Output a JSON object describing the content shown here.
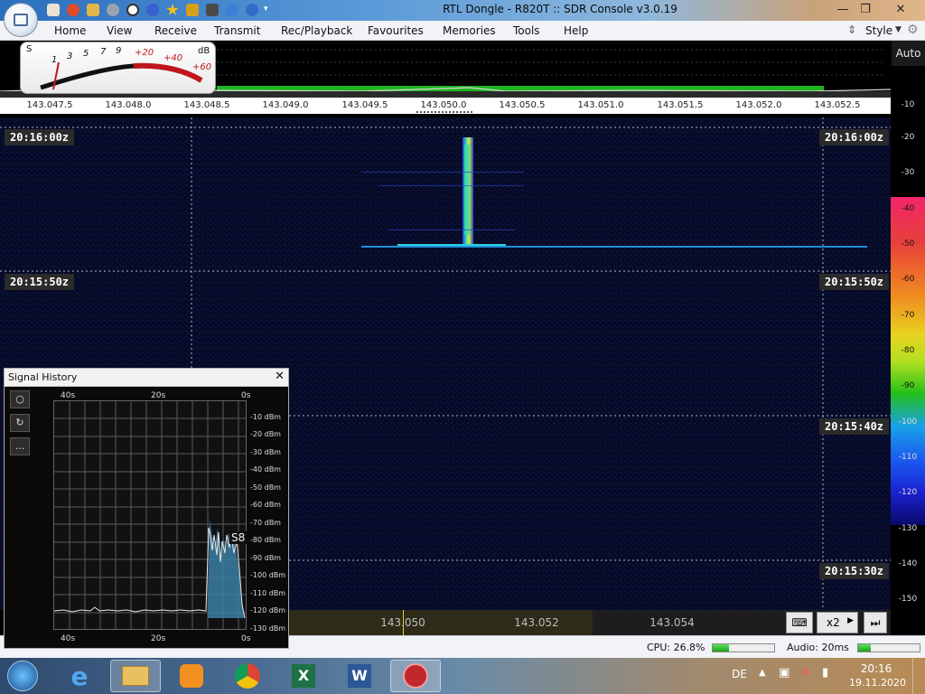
{
  "window": {
    "title": "RTL Dongle - R820T :: SDR Console v3.0.19",
    "minimize": "—",
    "maximize": "❐",
    "close": "✕"
  },
  "menu": {
    "items": [
      "Home",
      "View",
      "Receive",
      "Transmit",
      "Rec/Playback",
      "Favourites",
      "Memories",
      "Tools",
      "Help"
    ],
    "style_label": "Style"
  },
  "smeter": {
    "s_label": "S",
    "db_label": "dB",
    "s_scale": [
      "1",
      "3",
      "5",
      "7",
      "9"
    ],
    "db_scale": [
      "+20",
      "+40",
      "+60"
    ]
  },
  "spectrum": {
    "auto_label": "Auto"
  },
  "freq_axis": {
    "ticks": [
      "143.047.5",
      "143.048.0",
      "143.048.5",
      "143.049.0",
      "143.049.5",
      "143.050.0",
      "143.050.5",
      "143.051.0",
      "143.051.5",
      "143.052.0",
      "143.052.5"
    ]
  },
  "waterfall": {
    "time_labels": [
      "20:16:00z",
      "20:15:50z",
      "20:15:40z",
      "20:15:30z"
    ]
  },
  "color_scale": {
    "ticks": [
      "-10",
      "-20",
      "-30",
      "-40",
      "-50",
      "-60",
      "-70",
      "-80",
      "-90",
      "-100",
      "-110",
      "-120",
      "-130",
      "-140",
      "-150"
    ]
  },
  "bottom_ruler": {
    "freqs": [
      "143.050",
      "143.052",
      "143.054"
    ],
    "zoom": "x2"
  },
  "status": {
    "cpu": "CPU: 26.8%",
    "cpu_fraction": 0.268,
    "audio": "Audio: 20ms",
    "audio_fraction": 0.2
  },
  "signal_history": {
    "title": "Signal History",
    "close": "✕",
    "tools": [
      "○",
      "↻",
      "..."
    ],
    "time_top": [
      "40s",
      "20s",
      "0s"
    ],
    "time_bottom": [
      "40s",
      "20s",
      "0s"
    ],
    "db_labels": [
      "-10 dBm",
      "-20 dBm",
      "-30 dBm",
      "-40 dBm",
      "-50 dBm",
      "-60 dBm",
      "-70 dBm",
      "-80 dBm",
      "-90 dBm",
      "-100 dBm",
      "-110 dBm",
      "-120 dBm",
      "-130 dBm"
    ],
    "s_reading": "S8"
  },
  "taskbar": {
    "language": "DE",
    "time": "20:16",
    "date": "19.11.2020",
    "apps": [
      "start-orb-icon",
      "internet-explorer-icon",
      "file-explorer-icon",
      "media-player-icon",
      "chrome-icon",
      "excel-icon",
      "word-icon",
      "sdr-console-icon"
    ]
  }
}
